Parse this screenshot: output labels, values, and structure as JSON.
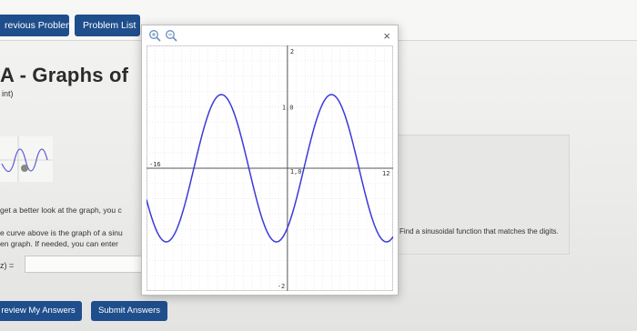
{
  "nav": {
    "previous_label": "revious Problem",
    "list_label": "Problem List"
  },
  "problem": {
    "title": "A - Graphs of",
    "points": "int)",
    "hint_line": "get a better look at the graph, you c",
    "desc_line1": "e curve above is the graph of a sinu",
    "desc_line2": "en graph. If needed, you can enter",
    "answer_label": "z) =",
    "answer_value": "",
    "side_text": "Find a sinusoidal function that matches the digits."
  },
  "buttons": {
    "review_label": "review My Answers",
    "submit_label": "Submit Answers"
  },
  "popup": {
    "zoom_in_icon": "zoom-in-icon",
    "zoom_out_icon": "zoom-out-icon",
    "close_label": "×"
  },
  "chart_data": {
    "type": "line",
    "xlim": [
      -16,
      12
    ],
    "ylim": [
      -2,
      2
    ],
    "grid": true,
    "tick_labels": {
      "x_min": "-16",
      "x_max": "12",
      "y_max": "2",
      "y_min": "-2",
      "point_x": "1,0",
      "point_y": "1,0"
    },
    "series": [
      {
        "color": "#3b3bd8",
        "function": "sinusoid",
        "amplitude": 1.2,
        "midline": 0,
        "period": 12.5,
        "peak_x": -7.5
      }
    ]
  }
}
